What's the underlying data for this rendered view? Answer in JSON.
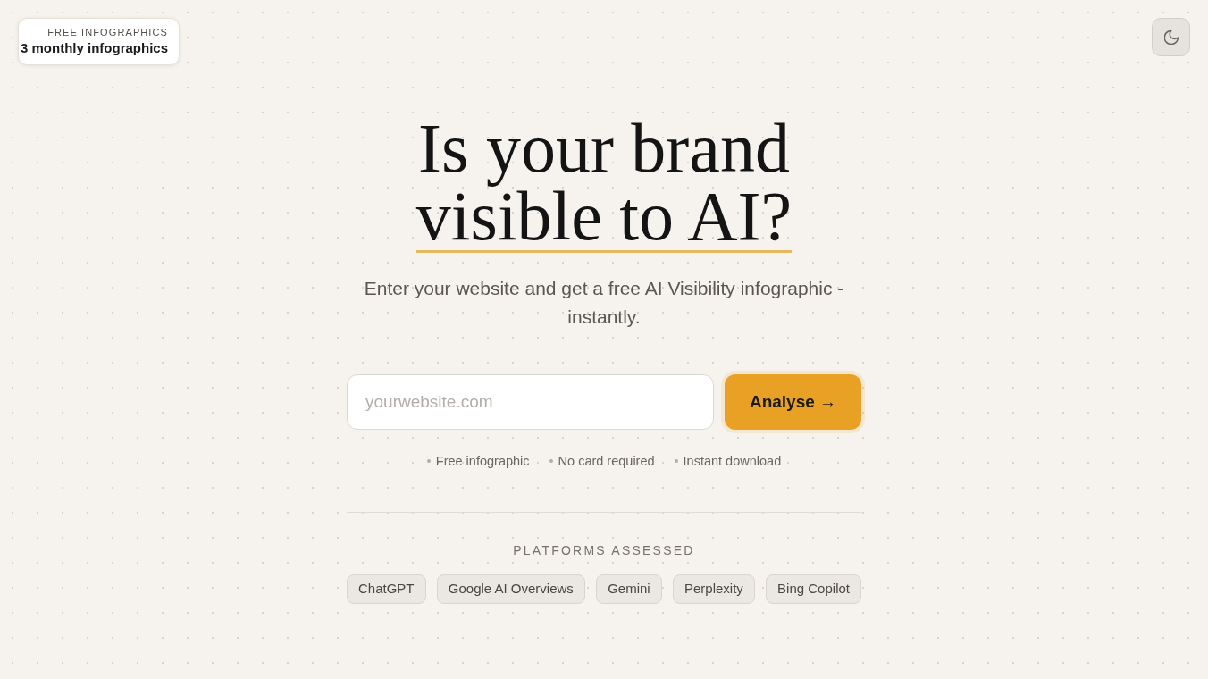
{
  "plan_badge": {
    "label": "FREE INFOGRAPHICS",
    "value": "3 monthly infographics"
  },
  "hero": {
    "title": "Is your brand",
    "title_highlight": "visible to AI?",
    "subtitle": "Enter your website and get a free AI Visibility infographic - instantly."
  },
  "search": {
    "placeholder": "yourwebsite.com",
    "button": "Analyse →"
  },
  "perks": [
    "Free infographic",
    "No card required",
    "Instant download"
  ],
  "platforms": {
    "heading": "PLATFORMS ASSESSED",
    "items": [
      "ChatGPT",
      "Google AI Overviews",
      "Gemini",
      "Perplexity",
      "Bing Copilot"
    ]
  }
}
